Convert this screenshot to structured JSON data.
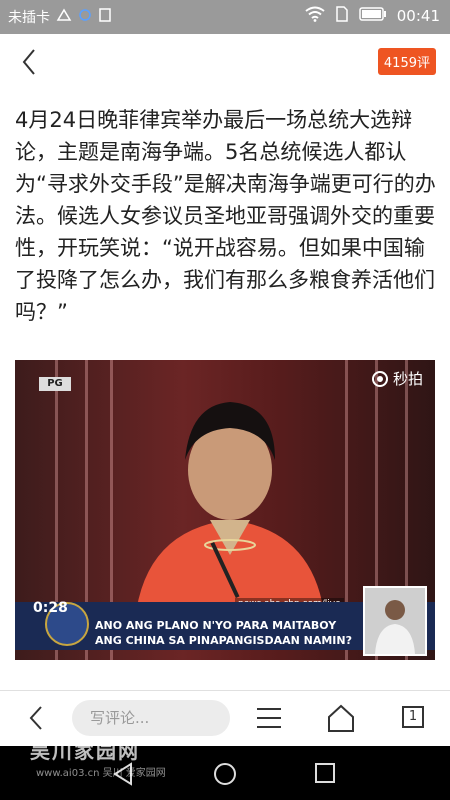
{
  "status_bar": {
    "carrier": "未插卡",
    "time": "00:41"
  },
  "top_bar": {
    "comment_count": "4159评"
  },
  "article": {
    "text": "4月24日晚菲律宾举办最后一场总统大选辩论，主题是南海争端。5名总统候选人都认为“寻求外交手段”是解决南海争端更可行的办法。候选人女参议员圣地亚哥强调外交的重要性，开玩笑说：“说开战容易。但如果中国输了投降了怎么办，我们有那么多粮食养活他们吗？”",
    "photo": {
      "rating_badge": "PG",
      "video_brand": "秒拍",
      "timer": "0:28",
      "caption": "ANO ANG PLANO N'YO PARA MAITABOY\nANG CHINA SA PINAPANGISDAAN NAMIN?",
      "url": "news.abs-cbn.com/live"
    }
  },
  "toolbar": {
    "comment_placeholder": "写评论...",
    "page_count": "1"
  },
  "watermark": {
    "brand": "吴川家园网",
    "url": "www.ai03.cn 吴川 爱家园网"
  },
  "colors": {
    "accent": "#ee5522",
    "status_bar": "#9a9a9a"
  }
}
